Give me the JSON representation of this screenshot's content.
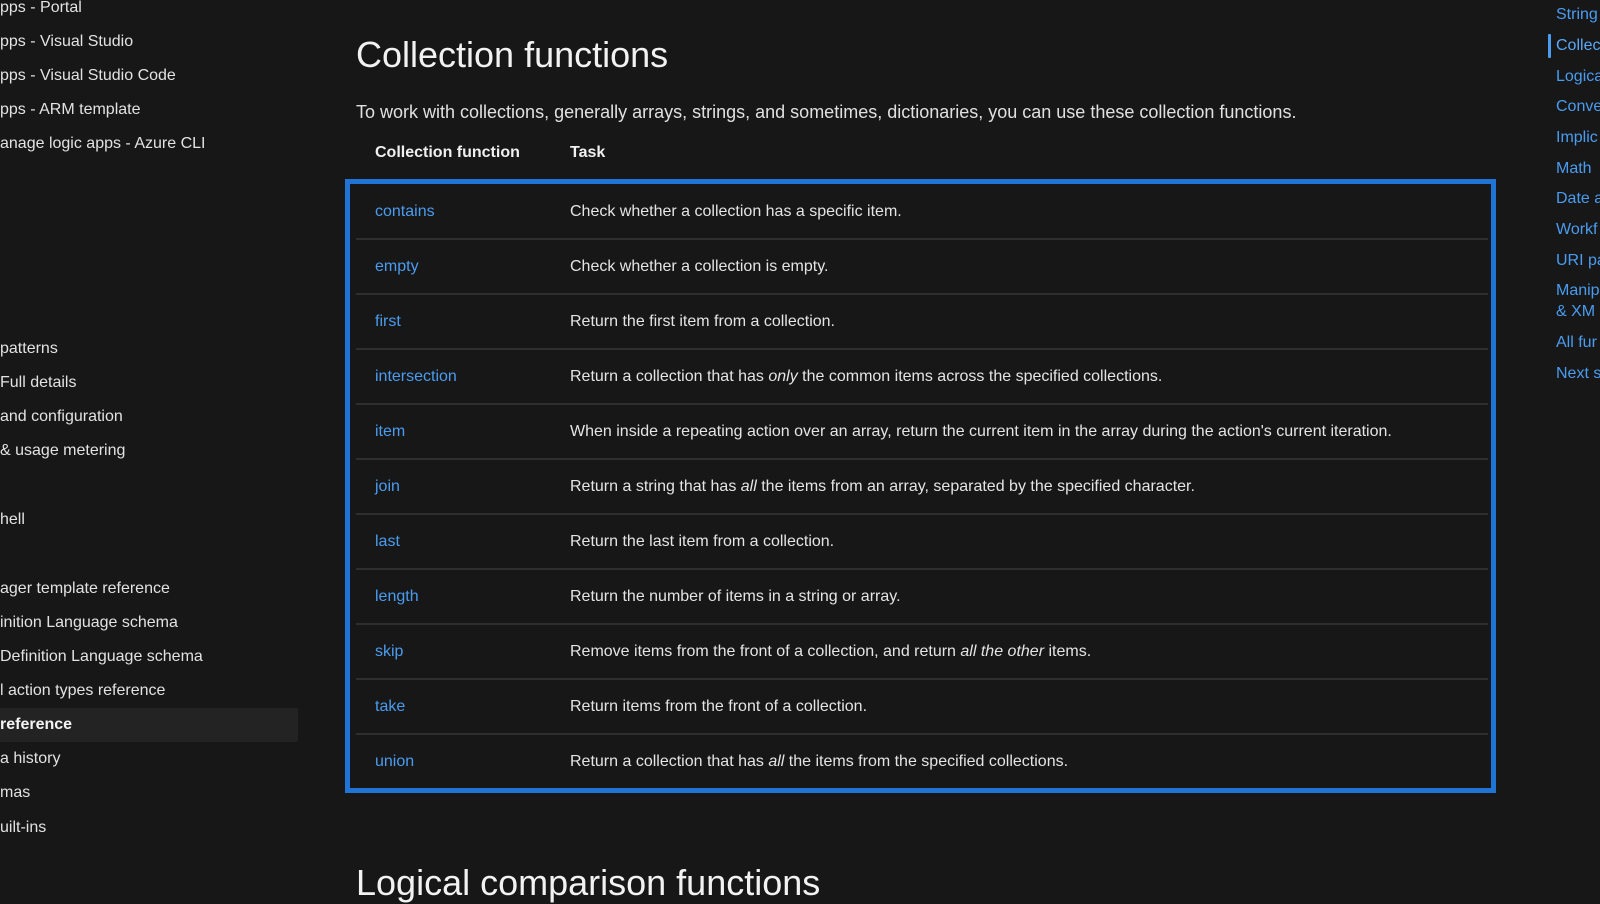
{
  "left_nav": {
    "items": [
      {
        "label": "pps - Portal",
        "active": false
      },
      {
        "label": "pps - Visual Studio",
        "active": false
      },
      {
        "label": "pps - Visual Studio Code",
        "active": false
      },
      {
        "label": "pps - ARM template",
        "active": false
      },
      {
        "label": "anage logic apps - Azure CLI",
        "active": false
      },
      {
        "label": "patterns",
        "active": false
      },
      {
        "label": "Full details",
        "active": false
      },
      {
        "label": "and configuration",
        "active": false
      },
      {
        "label": " & usage metering",
        "active": false
      },
      {
        "label": "hell",
        "active": false
      },
      {
        "label": "ager template reference",
        "active": false
      },
      {
        "label": "inition Language schema",
        "active": false
      },
      {
        "label": "Definition Language schema",
        "active": false
      },
      {
        "label": "l action types reference",
        "active": false
      },
      {
        "label": "reference",
        "active": true
      },
      {
        "label": "a history",
        "active": false
      },
      {
        "label": "mas",
        "active": false
      },
      {
        "label": "uilt-ins",
        "active": false
      }
    ]
  },
  "main": {
    "title": "Collection functions",
    "intro": "To work with collections, generally arrays, strings, and sometimes, dictionaries, you can use these collection functions.",
    "table": {
      "headers": [
        "Collection function",
        "Task"
      ],
      "rows": [
        {
          "fn": "contains",
          "task": [
            "Check whether a collection has a specific item."
          ]
        },
        {
          "fn": "empty",
          "task": [
            "Check whether a collection is empty."
          ]
        },
        {
          "fn": "first",
          "task": [
            "Return the first item from a collection."
          ]
        },
        {
          "fn": "intersection",
          "task": [
            "Return a collection that has ",
            "only",
            " the common items across the specified collections."
          ]
        },
        {
          "fn": "item",
          "task": [
            "When inside a repeating action over an array, return the current item in the array during the action's current iteration."
          ]
        },
        {
          "fn": "join",
          "task": [
            "Return a string that has ",
            "all",
            " the items from an array, separated by the specified character."
          ]
        },
        {
          "fn": "last",
          "task": [
            "Return the last item from a collection."
          ]
        },
        {
          "fn": "length",
          "task": [
            "Return the number of items in a string or array."
          ]
        },
        {
          "fn": "skip",
          "task": [
            "Remove items from the front of a collection, and return ",
            "all the other",
            " items."
          ]
        },
        {
          "fn": "take",
          "task": [
            "Return items from the front of a collection."
          ]
        },
        {
          "fn": "union",
          "task": [
            "Return a collection that has ",
            "all",
            " the items from the specified collections."
          ]
        }
      ]
    },
    "next_heading": "Logical comparison functions"
  },
  "toc": {
    "items": [
      {
        "label": "String",
        "active": false
      },
      {
        "label": "Collec",
        "active": true
      },
      {
        "label": "Logica",
        "active": false
      },
      {
        "label": "Conve",
        "active": false
      },
      {
        "label": "Implic",
        "active": false
      },
      {
        "label": "Math",
        "active": false
      },
      {
        "label": "Date a",
        "active": false
      },
      {
        "label": "Workf",
        "active": false
      },
      {
        "label": "URI pa",
        "active": false
      },
      {
        "label": "Manip",
        "active": false
      },
      {
        "label": "& XM",
        "active": false
      },
      {
        "label": "All fur",
        "active": false
      },
      {
        "label": "Next s",
        "active": false
      }
    ]
  },
  "colors": {
    "accent": "#1f74d6",
    "link": "#4a9cf0",
    "background": "#171717"
  }
}
